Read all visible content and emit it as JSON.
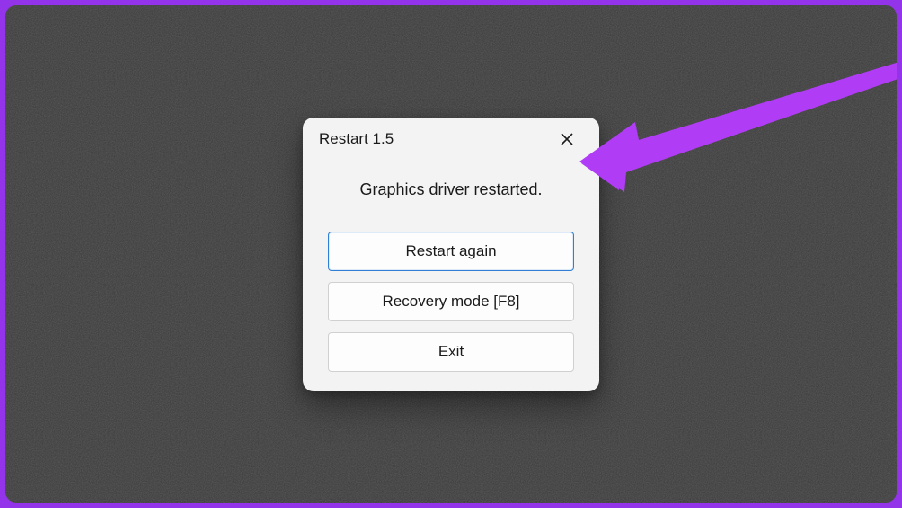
{
  "dialog": {
    "title": "Restart 1.5",
    "message": "Graphics driver restarted.",
    "buttons": {
      "restart_again": "Restart again",
      "recovery_mode": "Recovery mode [F8]",
      "exit": "Exit"
    }
  },
  "annotation": {
    "arrow_color": "#b03cf5"
  }
}
